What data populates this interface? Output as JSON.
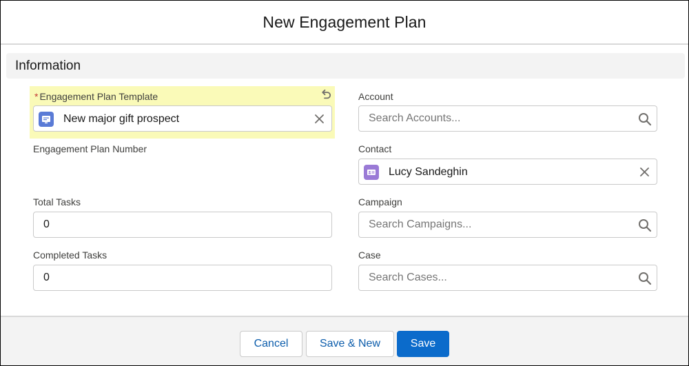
{
  "modal": {
    "title": "New Engagement Plan"
  },
  "section": {
    "title": "Information"
  },
  "fields": {
    "template": {
      "required_marker": "*",
      "label": "Engagement Plan Template",
      "value": "New major gift prospect",
      "icon": "template-record-icon",
      "icon_color": "#5a7bd6"
    },
    "plan_number": {
      "label": "Engagement Plan Number"
    },
    "total_tasks": {
      "label": "Total Tasks",
      "value": "0"
    },
    "completed_tasks": {
      "label": "Completed Tasks",
      "value": "0"
    },
    "account": {
      "label": "Account",
      "placeholder": "Search Accounts..."
    },
    "contact": {
      "label": "Contact",
      "value": "Lucy Sandeghin",
      "icon": "contact-card-icon",
      "icon_color": "#9a7ad6"
    },
    "campaign": {
      "label": "Campaign",
      "placeholder": "Search Campaigns..."
    },
    "case": {
      "label": "Case",
      "placeholder": "Search Cases..."
    }
  },
  "footer": {
    "cancel_label": "Cancel",
    "save_new_label": "Save & New",
    "save_label": "Save"
  },
  "colors": {
    "brand": "#0b6bcb",
    "highlight": "#fafab8",
    "section_bg": "#f3f3f3",
    "required": "#c23934"
  }
}
